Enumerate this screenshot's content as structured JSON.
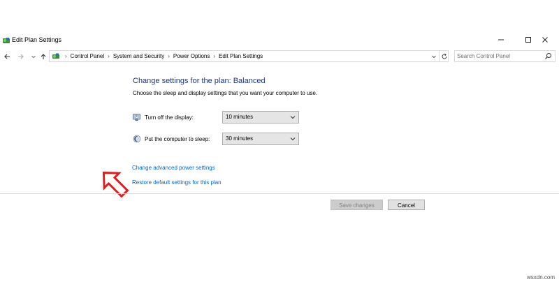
{
  "window": {
    "title": "Edit Plan Settings"
  },
  "address": {
    "breadcrumbs": [
      "Control Panel",
      "System and Security",
      "Power Options",
      "Edit Plan Settings"
    ]
  },
  "search": {
    "placeholder": "Search Control Panel"
  },
  "content": {
    "title": "Change settings for the plan: Balanced",
    "subtitle": "Choose the sleep and display settings that you want your computer to use.",
    "display_label": "Turn off the display:",
    "display_value": "10 minutes",
    "sleep_label": "Put the computer to sleep:",
    "sleep_value": "30 minutes",
    "advanced_link": "Change advanced power settings",
    "restore_link": "Restore default settings for this plan"
  },
  "buttons": {
    "save": "Save changes",
    "cancel": "Cancel"
  },
  "watermark": "wsxdn.com",
  "colors": {
    "title_blue": "#1e3287",
    "link_blue": "#0066cc",
    "arrow_red": "#e01e1e"
  },
  "icons": {
    "app": "control-panel-icon",
    "display": "monitor-clock-icon",
    "sleep": "moon-icon"
  }
}
